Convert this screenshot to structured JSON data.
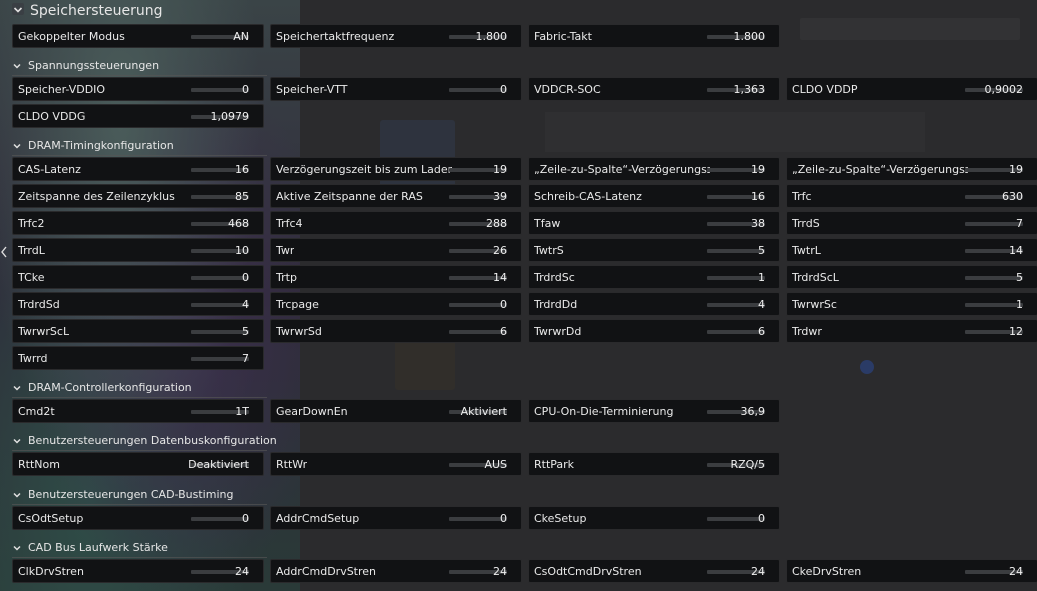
{
  "title": "Speichersteuerung",
  "top_row": [
    {
      "label": "Gekoppelter Modus",
      "value": "AN"
    },
    {
      "label": "Speichertaktfrequenz",
      "value": "1.800"
    },
    {
      "label": "Fabric-Takt",
      "value": "1.800"
    }
  ],
  "sections": [
    {
      "title": "Spannungssteuerungen",
      "rows": [
        [
          {
            "label": "Speicher-VDDIO",
            "value": "0"
          },
          {
            "label": "Speicher-VTT",
            "value": "0"
          },
          {
            "label": "VDDCR-SOC",
            "value": "1,363"
          },
          {
            "label": "CLDO VDDP",
            "value": "0,9002"
          }
        ],
        [
          {
            "label": "CLDO VDDG",
            "value": "1,0979"
          }
        ]
      ]
    },
    {
      "title": "DRAM-Timingkonfiguration",
      "rows": [
        [
          {
            "label": "CAS-Latenz",
            "value": "16"
          },
          {
            "label": "Verzögerungszeit bis zum Laden ...",
            "value": "19"
          },
          {
            "label": "„Zeile-zu-Spalte“-Verzögerungsze...",
            "value": "19"
          },
          {
            "label": "„Zeile-zu-Spalte“-Verzögerungsze...",
            "value": "19"
          }
        ],
        [
          {
            "label": "Zeitspanne des Zeilenzyklus",
            "value": "85"
          },
          {
            "label": "Aktive Zeitspanne der RAS",
            "value": "39"
          },
          {
            "label": "Schreib-CAS-Latenz",
            "value": "16"
          },
          {
            "label": "Trfc",
            "value": "630"
          }
        ],
        [
          {
            "label": "Trfc2",
            "value": "468"
          },
          {
            "label": "Trfc4",
            "value": "288"
          },
          {
            "label": "Tfaw",
            "value": "38"
          },
          {
            "label": "TrrdS",
            "value": "7"
          }
        ],
        [
          {
            "label": "TrrdL",
            "value": "10"
          },
          {
            "label": "Twr",
            "value": "26"
          },
          {
            "label": "TwtrS",
            "value": "5"
          },
          {
            "label": "TwtrL",
            "value": "14"
          }
        ],
        [
          {
            "label": "TCke",
            "value": "0"
          },
          {
            "label": "Trtp",
            "value": "14"
          },
          {
            "label": "TrdrdSc",
            "value": "1"
          },
          {
            "label": "TrdrdScL",
            "value": "5"
          }
        ],
        [
          {
            "label": "TrdrdSd",
            "value": "4"
          },
          {
            "label": "Trcpage",
            "value": "0"
          },
          {
            "label": "TrdrdDd",
            "value": "4"
          },
          {
            "label": "TwrwrSc",
            "value": "1"
          }
        ],
        [
          {
            "label": "TwrwrScL",
            "value": "5"
          },
          {
            "label": "TwrwrSd",
            "value": "6"
          },
          {
            "label": "TwrwrDd",
            "value": "6"
          },
          {
            "label": "Trdwr",
            "value": "12"
          }
        ],
        [
          {
            "label": "Twrrd",
            "value": "7"
          }
        ]
      ]
    },
    {
      "title": "DRAM-Controllerkonfiguration",
      "rows": [
        [
          {
            "label": "Cmd2t",
            "value": "1T"
          },
          {
            "label": "GearDownEn",
            "value": "Aktiviert"
          },
          {
            "label": "CPU-On-Die-Terminierung",
            "value": "36,9"
          }
        ]
      ]
    },
    {
      "title": "Benutzersteuerungen Datenbuskonfiguration",
      "rows": [
        [
          {
            "label": "RttNom",
            "value": "Deaktiviert"
          },
          {
            "label": "RttWr",
            "value": "AUS"
          },
          {
            "label": "RttPark",
            "value": "RZQ/5"
          }
        ]
      ]
    },
    {
      "title": "Benutzersteuerungen CAD-Bustiming",
      "rows": [
        [
          {
            "label": "CsOdtSetup",
            "value": "0"
          },
          {
            "label": "AddrCmdSetup",
            "value": "0"
          },
          {
            "label": "CkeSetup",
            "value": "0"
          }
        ]
      ]
    },
    {
      "title": "CAD Bus Laufwerk Stärke",
      "rows": [
        [
          {
            "label": "ClkDrvStren",
            "value": "24"
          },
          {
            "label": "AddrCmdDrvStren",
            "value": "24"
          },
          {
            "label": "CsOdtCmdDrvStren",
            "value": "24"
          },
          {
            "label": "CkeDrvStren",
            "value": "24"
          }
        ]
      ]
    }
  ]
}
